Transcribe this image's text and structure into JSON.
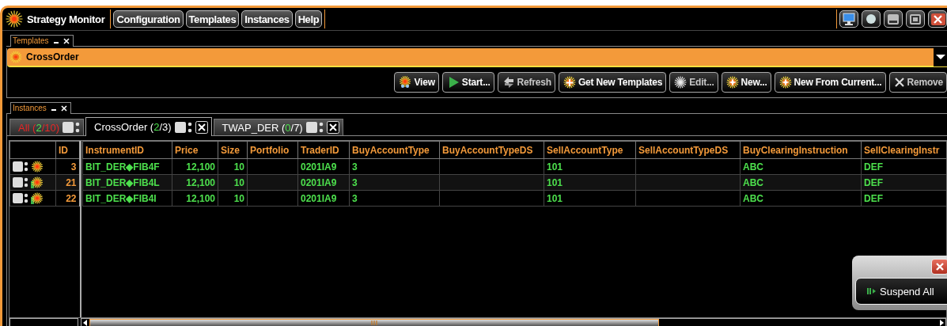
{
  "app": {
    "title": "Strategy Monitor"
  },
  "menu": [
    {
      "label": "Configuration"
    },
    {
      "label": "Templates"
    },
    {
      "label": "Instances"
    },
    {
      "label": "Help"
    }
  ],
  "templates_panel": {
    "title": "Templates",
    "template": "CrossOrder",
    "buttons": [
      {
        "kind": "view",
        "label": "View",
        "disabled": false
      },
      {
        "kind": "start",
        "label": "Start...",
        "disabled": false
      },
      {
        "kind": "refresh",
        "label": "Refresh",
        "disabled": true
      },
      {
        "kind": "get",
        "label": "Get New Templates",
        "disabled": false
      },
      {
        "kind": "edit",
        "label": "Edit...",
        "disabled": true
      },
      {
        "kind": "new",
        "label": "New...",
        "disabled": false
      },
      {
        "kind": "new",
        "label": "New From Current...",
        "disabled": false
      },
      {
        "kind": "remove",
        "label": "Remove",
        "disabled": true
      }
    ]
  },
  "instances_panel": {
    "title": "Instances",
    "tabs": [
      {
        "label": "All",
        "before": "(",
        "active": "2",
        "after": "/10)",
        "selected": false,
        "closable": false,
        "color": "#e82626"
      },
      {
        "label": "CrossOrder",
        "before": "(",
        "active": "2",
        "after": "/3)",
        "selected": true,
        "closable": true,
        "color": "#ffffff"
      },
      {
        "label": "TWAP_DER",
        "before": "(",
        "active": "0",
        "after": "/7)",
        "selected": false,
        "closable": true,
        "color": "#ffffff"
      }
    ],
    "table": {
      "id_column": "ID",
      "columns": [
        {
          "label": "InstrumentID",
          "kind": "text"
        },
        {
          "label": "Price",
          "kind": "number"
        },
        {
          "label": "Size",
          "kind": "number"
        },
        {
          "label": "Portfolio",
          "kind": "text"
        },
        {
          "label": "TraderID",
          "kind": "text"
        },
        {
          "label": "BuyAccountType",
          "kind": "text"
        },
        {
          "label": "BuyAccountTypeDS",
          "kind": "text"
        },
        {
          "label": "SellAccountType",
          "kind": "text"
        },
        {
          "label": "SellAccountTypeDS",
          "kind": "text"
        },
        {
          "label": "BuyClearingInstruction",
          "kind": "text"
        },
        {
          "label": "SellClearingInstr",
          "kind": "text"
        }
      ],
      "rows": [
        {
          "id": "3",
          "flagged": false,
          "cells": [
            "BIT_DER◆FIB4F",
            "12,100",
            "10",
            null,
            "0201IA9",
            "3",
            null,
            "101",
            null,
            "ABC",
            "DEF"
          ]
        },
        {
          "id": "21",
          "flagged": true,
          "cells": [
            "BIT_DER◆FIB4L",
            "12,100",
            "10",
            null,
            "0201IA9",
            "3",
            null,
            "101",
            null,
            "ABC",
            "DEF"
          ]
        },
        {
          "id": "22",
          "flagged": true,
          "cells": [
            "BIT_DER◆FIB4I",
            "12,100",
            "10",
            null,
            "0201IA9",
            "3",
            null,
            "101",
            null,
            "ABC",
            "DEF"
          ]
        }
      ]
    }
  },
  "popup": {
    "button": "Suspend All"
  }
}
